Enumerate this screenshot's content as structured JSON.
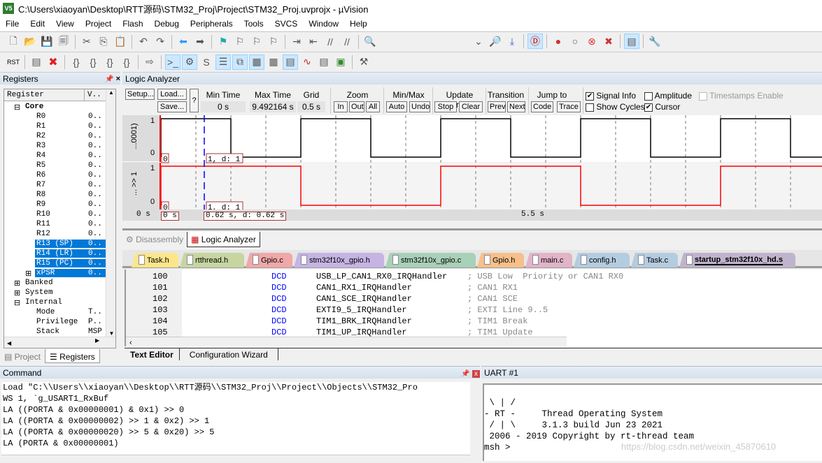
{
  "window": {
    "title": "C:\\Users\\xiaoyan\\Desktop\\RTT源码\\STM32_Proj\\Project\\STM32_Proj.uvprojx - µVision",
    "logo": "V5"
  },
  "menu": [
    "File",
    "Edit",
    "View",
    "Project",
    "Flash",
    "Debug",
    "Peripherals",
    "Tools",
    "SVCS",
    "Window",
    "Help"
  ],
  "toolbar1": [
    "new-file",
    "open-file",
    "save",
    "save-all",
    "|",
    "cut",
    "copy",
    "paste",
    "|",
    "undo",
    "redo",
    "|",
    "navigate-back",
    "navigate-forward",
    "|",
    "bookmark",
    "prev-bookmark",
    "next-bookmark",
    "clear-bookmarks",
    "|",
    "indent",
    "unindent",
    "comment",
    "uncomment",
    "|",
    "find-in-files"
  ],
  "toolbar1_right": [
    "dropdown",
    "find",
    "incremental-find",
    "|",
    "debug-session",
    "|",
    "breakpoint",
    "disable-breakpoint",
    "disable-all-breakpoints",
    "kill-breakpoints",
    "|",
    "window-layout",
    "|",
    "configure"
  ],
  "toolbar2": [
    "reset",
    "|",
    "run",
    "stop",
    "|",
    "step-into",
    "step-over",
    "step-out",
    "run-to-cursor",
    "|",
    "show-next-statement",
    "|",
    "command-window",
    "disassembly-window",
    "symbols-window",
    "registers-window",
    "call-stack-window",
    "watch-window",
    "memory-window",
    "serial-window",
    "analysis-window",
    "trace-window",
    "system-viewer",
    "|",
    "toolbox"
  ],
  "toolbar2_labels": {
    "reset": "RST"
  },
  "registers": {
    "title": "Registers",
    "col_register": "Register",
    "col_value": "V..",
    "core_label": "Core",
    "core": [
      {
        "n": "R0",
        "v": "0.."
      },
      {
        "n": "R1",
        "v": "0.."
      },
      {
        "n": "R2",
        "v": "0.."
      },
      {
        "n": "R3",
        "v": "0.."
      },
      {
        "n": "R4",
        "v": "0.."
      },
      {
        "n": "R5",
        "v": "0.."
      },
      {
        "n": "R6",
        "v": "0.."
      },
      {
        "n": "R7",
        "v": "0.."
      },
      {
        "n": "R8",
        "v": "0.."
      },
      {
        "n": "R9",
        "v": "0.."
      },
      {
        "n": "R10",
        "v": "0.."
      },
      {
        "n": "R11",
        "v": "0.."
      },
      {
        "n": "R12",
        "v": "0.."
      },
      {
        "n": "R13 (SP)",
        "v": "0..",
        "sel": true
      },
      {
        "n": "R14 (LR)",
        "v": "0..",
        "sel": true
      },
      {
        "n": "R15 (PC)",
        "v": "0..",
        "sel": true
      },
      {
        "n": "xPSR",
        "v": "0..",
        "sel": true,
        "plus": true
      }
    ],
    "groups": [
      "Banked",
      "System",
      "Internal"
    ],
    "internal": [
      {
        "n": "Mode",
        "v": "T.."
      },
      {
        "n": "Privilege",
        "v": "P.."
      },
      {
        "n": "Stack",
        "v": "MSP"
      }
    ],
    "tabs": [
      "Project",
      "Registers"
    ]
  },
  "la": {
    "title": "Logic Analyzer",
    "setup": "Setup...",
    "load": "Load...",
    "save": "Save...",
    "help": "?",
    "min_time_label": "Min Time",
    "min_time": "0 s",
    "max_time_label": "Max Time",
    "max_time": "9.492164 s",
    "grid_label": "Grid",
    "grid": "0.5 s",
    "zoom_label": "Zoom",
    "zoom": [
      "In",
      "Out",
      "All"
    ],
    "minmax_label": "Min/Max",
    "minmax": [
      "Auto",
      "Undo"
    ],
    "update_label": "Update Screen",
    "update": [
      "Stop",
      "Clear"
    ],
    "transition_label": "Transition",
    "transition": [
      "Prev",
      "Next"
    ],
    "jump_label": "Jump to",
    "jump": [
      "Code",
      "Trace"
    ],
    "signal_info": {
      "label": "Signal Info",
      "checked": true
    },
    "amplitude": {
      "label": "Amplitude",
      "checked": false
    },
    "timestamps": {
      "label": "Timestamps Enable",
      "checked": false
    },
    "show_cycles": {
      "label": "Show Cycles",
      "checked": false
    },
    "cursor": {
      "label": "Cursor",
      "checked": true
    },
    "signals": [
      {
        "name": "...0001)",
        "hi": "1",
        "lo": "0",
        "color": "#000000",
        "start_label": "0",
        "cursor_label": "1,   d: 1",
        "transitions": [
          0,
          1,
          2,
          3,
          4,
          5,
          6,
          7,
          8,
          9
        ],
        "initial": 1
      },
      {
        "name": "... >> 1",
        "hi": "1",
        "lo": "0",
        "color": "#ff0000",
        "start_label": "0",
        "cursor_label": "1,   d: 1",
        "transitions": [
          0,
          2,
          4,
          6,
          8
        ],
        "initial": 1
      }
    ],
    "time_left": "0 s",
    "time_start": "0 s",
    "cursor_time": "0.62 s,   d: 0.62 s",
    "time_mid": "5.5 s",
    "cursor_s": 0.62,
    "grid_s": 0.5,
    "end_s": 9.492164
  },
  "view_tabs": [
    "Disassembly",
    "Logic Analyzer"
  ],
  "file_tabs": [
    {
      "n": "Task.h",
      "c": "#fde68a"
    },
    {
      "n": "rtthread.h",
      "c": "#c7d6a0"
    },
    {
      "n": "Gpio.c",
      "c": "#f0a8a8"
    },
    {
      "n": "stm32f10x_gpio.h",
      "c": "#c6b4e4"
    },
    {
      "n": "stm32f10x_gpio.c",
      "c": "#a9d0b8"
    },
    {
      "n": "Gpio.h",
      "c": "#f7c08a"
    },
    {
      "n": "main.c",
      "c": "#e2b4c8"
    },
    {
      "n": "config.h",
      "c": "#b4cce0"
    },
    {
      "n": "Task.c",
      "c": "#b4cce0"
    },
    {
      "n": "startup_stm32f10x_hd.s",
      "c": "#c0b4cc",
      "active": true
    }
  ],
  "code": [
    {
      "ln": "100",
      "kw": "DCD",
      "sym": "USB_LP_CAN1_RX0_IRQHandler",
      "cm": "; USB Low  Priority or CAN1 RX0"
    },
    {
      "ln": "101",
      "kw": "DCD",
      "sym": "CAN1_RX1_IRQHandler",
      "cm": "; CAN1 RX1"
    },
    {
      "ln": "102",
      "kw": "DCD",
      "sym": "CAN1_SCE_IRQHandler",
      "cm": "; CAN1 SCE"
    },
    {
      "ln": "103",
      "kw": "DCD",
      "sym": "EXTI9_5_IRQHandler",
      "cm": "; EXTI Line 9..5"
    },
    {
      "ln": "104",
      "kw": "DCD",
      "sym": "TIM1_BRK_IRQHandler",
      "cm": "; TIM1 Break"
    },
    {
      "ln": "105",
      "kw": "DCD",
      "sym": "TIM1_UP_IRQHandler",
      "cm": "; TIM1 Update"
    }
  ],
  "editor_tabs": [
    "Text Editor",
    "Configuration Wizard"
  ],
  "command": {
    "title": "Command",
    "lines": [
      "Load \"C:\\\\Users\\\\xiaoyan\\\\Desktop\\\\RTT源码\\\\STM32_Proj\\\\Project\\\\Objects\\\\STM32_Pro",
      "WS 1, `g_USART1_RxBuf",
      "LA ((PORTA & 0x00000001) & 0x1) >> 0",
      "LA ((PORTA & 0x00000002) >> 1 & 0x2) >> 1",
      "LA ((PORTA & 0x00000020) >> 5 & 0x20) >> 5",
      "LA (PORTA & 0x00000001)"
    ]
  },
  "uart": {
    "title": "UART #1",
    "lines": [
      "",
      " \\ | /",
      "- RT -     Thread Operating System",
      " / | \\     3.1.3 build Jun 23 2021",
      " 2006 - 2019 Copyright by rt-thread team",
      "msh >"
    ],
    "watermark": "https://blog.csdn.net/weixin_45870610"
  }
}
